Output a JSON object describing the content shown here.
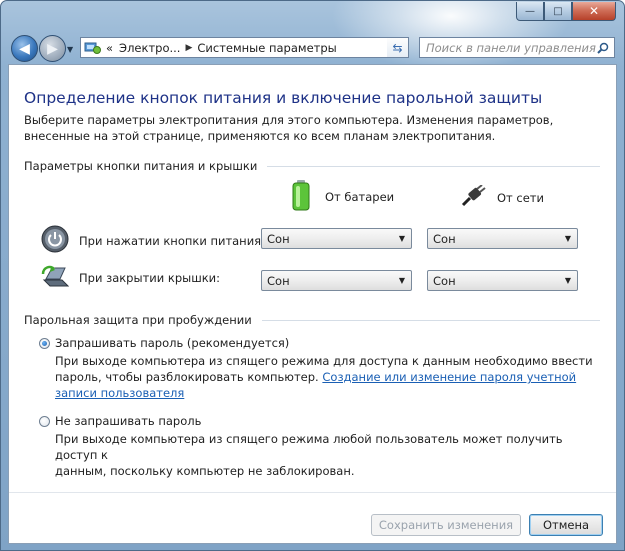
{
  "window": {
    "caption_buttons": {
      "minimize": "—",
      "maximize": "□",
      "close": "✕"
    }
  },
  "nav": {
    "back_glyph": "◀",
    "forward_glyph": "▶",
    "breadcrumb": {
      "overflow": "«",
      "parent": "Электро...",
      "current": "Системные параметры"
    },
    "search_placeholder": "Поиск в панели управления"
  },
  "page": {
    "title": "Определение кнопок питания и включение парольной защиты",
    "intro": "Выберите параметры электропитания для этого компьютера. Изменения параметров, внесенные на этой странице, применяются ко всем планам электропитания.",
    "power_section": {
      "heading": "Параметры кнопки питания и крышки",
      "col_battery": "От батареи",
      "col_plugged": "От сети",
      "rows": [
        {
          "label": "При нажатии кнопки питания:",
          "battery": "Сон",
          "plugged": "Сон"
        },
        {
          "label": "При закрытии крышки:",
          "battery": "Сон",
          "plugged": "Сон"
        }
      ]
    },
    "password_section": {
      "heading": "Парольная защита при пробуждении",
      "options": [
        {
          "label": "Запрашивать пароль (рекомендуется)",
          "selected": true,
          "desc_line1": "При выходе компьютера из спящего режима для доступа к данным необходимо ввести",
          "desc_line2": "пароль, чтобы разблокировать компьютер. ",
          "link": "Создание или изменение пароля учетной записи пользователя"
        },
        {
          "label": "Не запрашивать пароль",
          "selected": false,
          "desc_line1": "При выходе компьютера из спящего режима любой пользователь может получить доступ к",
          "desc_line2": "данным, поскольку компьютер не заблокирован."
        }
      ]
    }
  },
  "footer": {
    "save_label": "Сохранить изменения",
    "cancel_label": "Отмена"
  },
  "colors": {
    "title_blue": "#1e3287",
    "link_blue": "#1a5fb4",
    "frame_blue": "#8fb1d1"
  }
}
